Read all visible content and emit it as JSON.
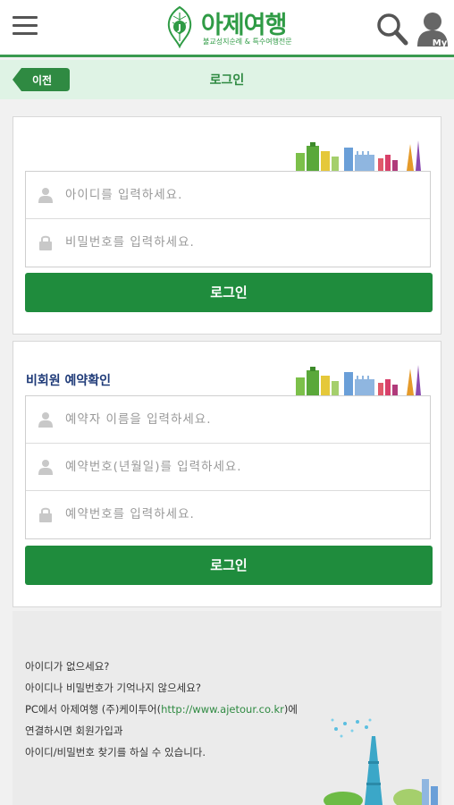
{
  "header": {
    "brand_name": "아제여행",
    "brand_tagline": "불교성지순례 & 특수여행전문",
    "logo_mark_text": "J",
    "icons": {
      "menu": "hamburger-icon",
      "search": "search-icon",
      "my": "user-icon"
    },
    "my_label": "My"
  },
  "subbar": {
    "back_label": "이전",
    "title": "로그인"
  },
  "login": {
    "id_placeholder": "아이디를 입력하세요.",
    "pw_placeholder": "비밀번호를 입력하세요.",
    "button_label": "로그인"
  },
  "guest": {
    "title": "비회원 예약확인",
    "name_placeholder": "예약자 이름을 입력하세요.",
    "birth_placeholder": "예약번호(년월일)를 입력하세요.",
    "number_placeholder": "예약번호를 입력하세요.",
    "button_label": "로그인"
  },
  "info": {
    "line1": "아이디가 없으세요?",
    "line2": "아이디나 비밀번호가 기억나지 않으세요?",
    "line3_prefix": "PC에서 아제여행 (주)케이투어(",
    "line3_link": "http://www.ajetour.co.kr",
    "line3_suffix": ")에",
    "line4": "연결하시면 회원가입과",
    "line5": "아이디/비밀번호 찾기를 하실 수 있습니다."
  },
  "colors": {
    "brand_green": "#2f9b45",
    "button_green": "#1f8c3d",
    "subbar_bg": "#dff3e5",
    "guest_title": "#1e3a78"
  }
}
